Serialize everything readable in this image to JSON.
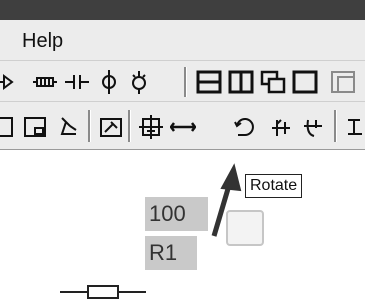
{
  "menubar": {
    "help": "Help"
  },
  "tooltip": {
    "text": "Rotate"
  },
  "component": {
    "value": "100",
    "ref": "R1"
  },
  "icons": {
    "toolbar1": [
      "diode-icon",
      "inductor-icon",
      "capacitor-icon",
      "current-source-icon",
      "ac-source-icon",
      "layout-horizontal-icon",
      "layout-vertical-icon",
      "cascade-windows-icon",
      "single-window-icon",
      "window-partial-icon"
    ],
    "toolbar2": [
      "page-icon",
      "page-frame-icon",
      "wire-tool-icon",
      "properties-icon",
      "ground-icon",
      "flip-horizontal-icon",
      "rotate-icon",
      "flip-icon",
      "mirror-icon",
      "clipped-icon"
    ]
  }
}
